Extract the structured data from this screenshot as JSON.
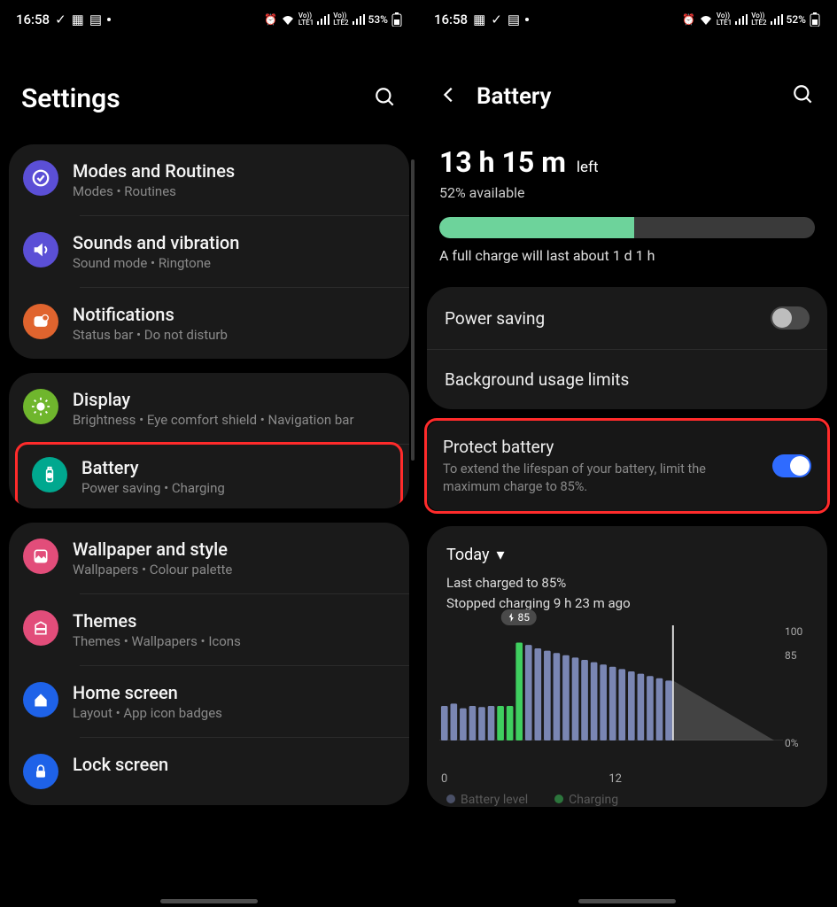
{
  "status_left": {
    "time": "16:58",
    "battery_pct": "53%"
  },
  "status_left2": {
    "time": "16:58",
    "battery_pct": "52%"
  },
  "settings": {
    "title": "Settings",
    "groups": [
      [
        {
          "title": "Modes and Routines",
          "sub": "Modes  •  Routines",
          "icon_bg": "#5b4fd6",
          "icon": "check"
        },
        {
          "title": "Sounds and vibration",
          "sub": "Sound mode  •  Ringtone",
          "icon_bg": "#5b4fd6",
          "icon": "sound"
        },
        {
          "title": "Notifications",
          "sub": "Status bar  •  Do not disturb",
          "icon_bg": "#e0642e",
          "icon": "notif"
        }
      ],
      [
        {
          "title": "Display",
          "sub": "Brightness  •  Eye comfort shield  •  Navigation bar",
          "icon_bg": "#6fb62d",
          "icon": "brightness"
        },
        {
          "title": "Battery",
          "sub": "Power saving  •  Charging",
          "icon_bg": "#00a88f",
          "icon": "battery",
          "highlight": true
        }
      ],
      [
        {
          "title": "Wallpaper and style",
          "sub": "Wallpapers  •  Colour palette",
          "icon_bg": "#e24d7a",
          "icon": "wallpaper"
        },
        {
          "title": "Themes",
          "sub": "Themes  •  Wallpapers  •  Icons",
          "icon_bg": "#e24d7a",
          "icon": "themes"
        },
        {
          "title": "Home screen",
          "sub": "Layout  •  App icon badges",
          "icon_bg": "#1e62e8",
          "icon": "home"
        },
        {
          "title": "Lock screen",
          "sub": "",
          "icon_bg": "#1e62e8",
          "icon": "lock"
        }
      ]
    ]
  },
  "battery": {
    "title": "Battery",
    "time_h": "13",
    "time_m": "15",
    "left_word": "left",
    "available": "52% available",
    "bar_pct": 52,
    "full_note": "A full charge will last about 1 d 1 h",
    "power_saving": "Power saving",
    "bg_limits": "Background usage limits",
    "protect_title": "Protect battery",
    "protect_sub": "To extend the lifespan of your battery, limit the maximum charge to 85%.",
    "today": "Today",
    "last_charged": "Last charged to 85%",
    "stopped": "Stopped charging 9 h 23 m ago",
    "marker": "85",
    "legend_level": "Battery level",
    "legend_charging": "Charging",
    "x_ticks": [
      "0",
      "12"
    ],
    "y_ticks": [
      "100",
      "85",
      "0%"
    ]
  },
  "chart_data": {
    "type": "bar",
    "title": "Today",
    "xlabel": "",
    "ylabel": "",
    "ylim": [
      0,
      100
    ],
    "y_ticks": [
      0,
      85,
      100
    ],
    "x_ticks": [
      0,
      12
    ],
    "marker_value": 85,
    "series": [
      {
        "name": "Battery level",
        "color": "#7a86b3",
        "values": [
          30,
          32,
          28,
          30,
          29,
          30,
          30,
          30,
          85,
          83,
          80,
          78,
          76,
          74,
          72,
          70,
          68,
          66,
          64,
          62,
          60,
          58,
          56,
          54,
          52
        ]
      },
      {
        "name": "Charging",
        "color": "#3fcf5f",
        "highlight_indices": [
          6,
          7,
          8
        ]
      }
    ],
    "predicted_line": [
      [
        24,
        52
      ],
      [
        36,
        0
      ]
    ]
  }
}
